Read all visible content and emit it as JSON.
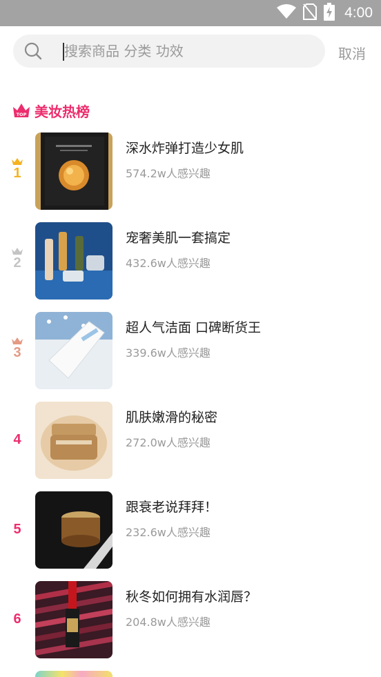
{
  "status_bar": {
    "time": "4:00",
    "icons": [
      "wifi-icon",
      "no-sim-icon",
      "battery-charging-icon"
    ]
  },
  "search": {
    "placeholder": "搜索商品 分类 功效",
    "value": "",
    "cancel_label": "取消"
  },
  "section": {
    "title": "美妆热榜",
    "icon": "crown-top-icon",
    "badge_text": "TOP"
  },
  "colors": {
    "accent": "#ec2d6e",
    "rank_gold": "#f5b321",
    "rank_silver": "#c4c4c4",
    "rank_bronze": "#e49a84",
    "rank_other": "#ec2d6e",
    "meta_text": "#9a9a9a"
  },
  "items": [
    {
      "rank": "1",
      "title": "深水炸弹打造少女肌",
      "meta": "574.2w人感兴趣",
      "crown": "gold-crown-icon"
    },
    {
      "rank": "2",
      "title": "宠奢美肌一套搞定",
      "meta": "432.6w人感兴趣",
      "crown": "silver-crown-icon"
    },
    {
      "rank": "3",
      "title": "超人气洁面 口碑断货王",
      "meta": "339.6w人感兴趣",
      "crown": "bronze-crown-icon"
    },
    {
      "rank": "4",
      "title": "肌肤嫩滑的秘密",
      "meta": "272.0w人感兴趣"
    },
    {
      "rank": "5",
      "title": "跟衰老说拜拜！",
      "meta": "232.6w人感兴趣"
    },
    {
      "rank": "6",
      "title": "秋冬如何拥有水润唇？",
      "meta": "204.8w人感兴趣"
    }
  ]
}
